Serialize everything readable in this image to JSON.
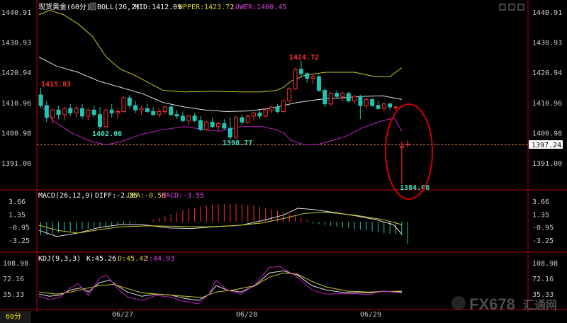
{
  "colors": {
    "bg": "#000000",
    "up": "#ff3030",
    "down": "#20c4b0",
    "mid": "#e8e8e8",
    "upper": "#c8c820",
    "lower": "#c020c8",
    "axis": "#b40000",
    "price_text": "#ffffff",
    "axis_label": "#c8c8c8",
    "highlight": "#d00000",
    "last_price_bg": "#ffffff"
  },
  "price_panel": {
    "title": "现货黄金(60分)",
    "indicator": "BOLL(26,2)",
    "mid_label": "MID:1412.09",
    "upper_label": "UPPER:1423.72",
    "lower_label": "LOWER:1400.45",
    "y_ticks": [
      "1440.91",
      "1430.93",
      "1420.94",
      "1410.96",
      "1400.98",
      "1391.00"
    ],
    "last_price": "1397.24",
    "annotations": {
      "high1": "1415.83",
      "low1": "1402.06",
      "low2": "1398.77",
      "high2": "1424.72",
      "low3": "1384.06"
    }
  },
  "macd_panel": {
    "title": "MACD(26,12,9)",
    "diff": "DIFF:-2.36",
    "dea": "DEA:-0.58",
    "macd": "MACD:-3.55",
    "y_ticks": [
      "3.66",
      "1.35",
      "-0.95",
      "-3.25"
    ]
  },
  "kdj_panel": {
    "title": "KDJ(9,3,3)",
    "k": "K:45.26",
    "d": "D:45.42",
    "j": "J:44.93",
    "y_ticks": [
      "108.98",
      "72.16",
      "35.33"
    ]
  },
  "x_axis": {
    "dates": [
      "06/27",
      "06/28",
      "06/29"
    ]
  },
  "footer": {
    "period": "60分",
    "brand": "FX678",
    "brand_cn": "汇通网"
  },
  "chart_data": {
    "type": "candlestick",
    "title": "现货黄金(60分)",
    "ylim": [
      1384,
      1442
    ],
    "highs_lows": {
      "1415.83": "high",
      "1402.06": "low",
      "1398.77": "low",
      "1424.72": "high",
      "1384.06": "low"
    },
    "candles": [
      [
        1413.5,
        1415.8,
        1409.0,
        1410.0
      ],
      [
        1410.0,
        1411.5,
        1404.5,
        1406.0
      ],
      [
        1406.0,
        1409.0,
        1404.0,
        1408.5
      ],
      [
        1408.5,
        1410.0,
        1405.5,
        1407.0
      ],
      [
        1407.0,
        1409.5,
        1405.0,
        1409.0
      ],
      [
        1409.0,
        1410.5,
        1406.5,
        1407.5
      ],
      [
        1407.5,
        1410.0,
        1406.0,
        1409.0
      ],
      [
        1409.0,
        1410.5,
        1405.5,
        1406.5
      ],
      [
        1406.5,
        1409.0,
        1405.0,
        1408.5
      ],
      [
        1408.5,
        1410.0,
        1406.0,
        1407.0
      ],
      [
        1407.0,
        1409.5,
        1402.1,
        1403.0
      ],
      [
        1403.0,
        1409.0,
        1402.5,
        1408.5
      ],
      [
        1408.5,
        1410.5,
        1406.0,
        1407.5
      ],
      [
        1407.5,
        1409.0,
        1405.5,
        1408.0
      ],
      [
        1408.0,
        1413.0,
        1407.5,
        1412.5
      ],
      [
        1412.5,
        1413.5,
        1409.0,
        1410.0
      ],
      [
        1410.0,
        1411.5,
        1407.5,
        1408.5
      ],
      [
        1408.5,
        1410.0,
        1407.0,
        1409.0
      ],
      [
        1409.0,
        1410.5,
        1407.5,
        1408.0
      ],
      [
        1408.0,
        1409.5,
        1406.5,
        1407.0
      ],
      [
        1407.0,
        1409.0,
        1406.0,
        1408.0
      ],
      [
        1408.0,
        1410.0,
        1407.0,
        1409.5
      ],
      [
        1409.5,
        1410.5,
        1406.5,
        1407.0
      ],
      [
        1407.0,
        1408.5,
        1405.5,
        1406.5
      ],
      [
        1406.5,
        1408.0,
        1404.5,
        1405.0
      ],
      [
        1405.0,
        1407.0,
        1403.5,
        1406.5
      ],
      [
        1406.5,
        1407.5,
        1404.5,
        1405.0
      ],
      [
        1405.0,
        1406.5,
        1401.5,
        1402.0
      ],
      [
        1402.0,
        1405.0,
        1401.5,
        1404.5
      ],
      [
        1404.5,
        1406.0,
        1402.5,
        1403.0
      ],
      [
        1403.0,
        1404.5,
        1401.5,
        1404.0
      ],
      [
        1404.0,
        1405.5,
        1402.0,
        1402.5
      ],
      [
        1402.5,
        1406.0,
        1398.8,
        1399.5
      ],
      [
        1399.5,
        1406.5,
        1399.0,
        1406.0
      ],
      [
        1406.0,
        1407.0,
        1403.5,
        1404.5
      ],
      [
        1404.5,
        1407.0,
        1404.0,
        1406.5
      ],
      [
        1406.5,
        1408.0,
        1405.0,
        1407.5
      ],
      [
        1407.5,
        1408.5,
        1405.5,
        1406.5
      ],
      [
        1406.5,
        1409.0,
        1406.0,
        1408.5
      ],
      [
        1408.5,
        1410.0,
        1407.5,
        1409.5
      ],
      [
        1409.5,
        1410.5,
        1407.5,
        1408.0
      ],
      [
        1408.0,
        1412.0,
        1407.5,
        1411.5
      ],
      [
        1411.5,
        1416.0,
        1411.0,
        1415.5
      ],
      [
        1415.5,
        1422.5,
        1415.0,
        1422.0
      ],
      [
        1422.0,
        1424.7,
        1419.5,
        1420.5
      ],
      [
        1420.5,
        1421.0,
        1417.5,
        1419.0
      ],
      [
        1419.0,
        1420.5,
        1417.0,
        1419.5
      ],
      [
        1419.5,
        1420.0,
        1414.5,
        1415.0
      ],
      [
        1415.0,
        1416.0,
        1409.5,
        1410.5
      ],
      [
        1410.5,
        1414.5,
        1410.0,
        1414.0
      ],
      [
        1414.0,
        1415.0,
        1412.5,
        1413.0
      ],
      [
        1413.0,
        1414.5,
        1411.5,
        1414.0
      ],
      [
        1414.0,
        1414.5,
        1411.0,
        1411.5
      ],
      [
        1411.5,
        1413.5,
        1410.5,
        1413.0
      ],
      [
        1413.0,
        1413.5,
        1405.5,
        1410.0
      ],
      [
        1410.0,
        1412.5,
        1409.0,
        1412.0
      ],
      [
        1412.0,
        1412.5,
        1409.5,
        1410.0
      ],
      [
        1410.0,
        1411.5,
        1408.5,
        1409.0
      ],
      [
        1409.0,
        1411.0,
        1408.0,
        1410.5
      ],
      [
        1410.5,
        1411.0,
        1408.5,
        1409.5
      ],
      [
        1409.5,
        1410.0,
        1408.5,
        1409.5
      ],
      [
        1396.0,
        1398.0,
        1384.06,
        1396.5
      ],
      [
        1397.0,
        1398.5,
        1396.0,
        1397.24
      ]
    ]
  }
}
